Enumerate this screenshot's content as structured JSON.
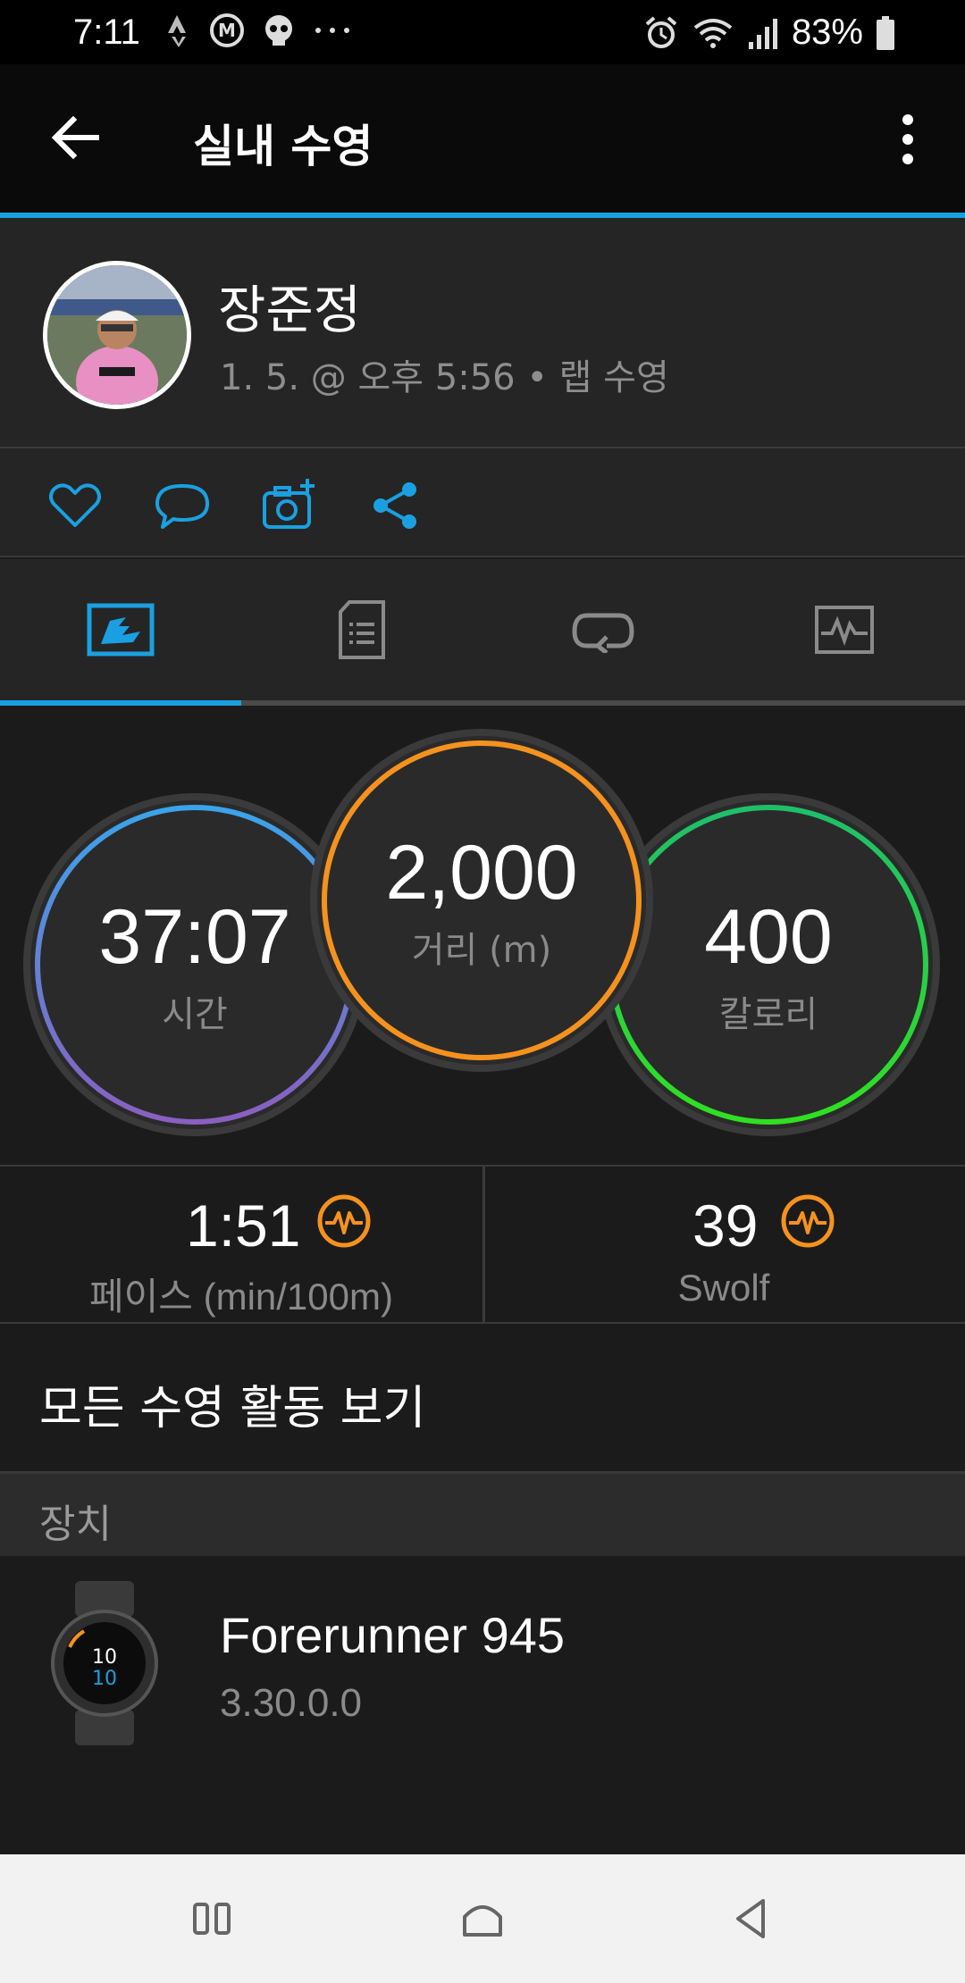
{
  "status_bar": {
    "time": "7:11",
    "battery": "83%"
  },
  "appbar": {
    "title": "실내 수영"
  },
  "profile": {
    "name": "장준정",
    "meta": "1. 5. @ 오후 5:56 • 랩 수영"
  },
  "actions": [
    "heart-icon",
    "comment-icon",
    "add-photo-icon",
    "share-icon"
  ],
  "tabs": [
    "summary-tab-icon",
    "details-tab-icon",
    "laps-tab-icon",
    "chart-tab-icon"
  ],
  "metrics": {
    "time": {
      "value": "37:07",
      "label": "시간"
    },
    "distance": {
      "value": "2,000",
      "label": "거리 (m)"
    },
    "calories": {
      "value": "400",
      "label": "칼로리"
    }
  },
  "stats": {
    "pace": {
      "value": "1:51",
      "label": "페이스 (min/100m)"
    },
    "swolf": {
      "value": "39",
      "label": "Swolf"
    }
  },
  "link": {
    "label": "모든 수영 활동 보기"
  },
  "section": {
    "title": "장치"
  },
  "device": {
    "name": "Forerunner 945",
    "version": "3.30.0.0"
  },
  "colors": {
    "accent": "#1aa0e0",
    "time_ring": "#3aa0e8",
    "distance_ring": "#f5921e",
    "calorie_ring": "#22d050",
    "badge": "#f5921e"
  }
}
